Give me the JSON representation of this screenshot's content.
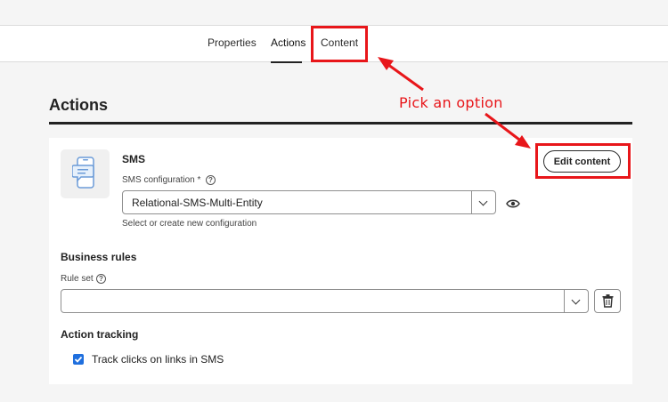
{
  "tabs": [
    {
      "label": "Properties"
    },
    {
      "label": "Actions"
    },
    {
      "label": "Content"
    }
  ],
  "active_tab": "Actions",
  "annotation": {
    "text": "Pick an option",
    "color": "#e8161a"
  },
  "section": {
    "title": "Actions"
  },
  "sms": {
    "title": "SMS",
    "config_label": "SMS configuration",
    "required_mark": "*",
    "config_value": "Relational-SMS-Multi-Entity",
    "helper": "Select or create new configuration",
    "edit_button": "Edit content"
  },
  "business_rules": {
    "title": "Business rules",
    "rule_set_label": "Rule set",
    "rule_set_value": ""
  },
  "action_tracking": {
    "title": "Action tracking",
    "checkbox_label": "Track clicks on links in SMS",
    "checked": true
  },
  "colors": {
    "accent": "#1f6fde",
    "callout": "#e8161a"
  }
}
